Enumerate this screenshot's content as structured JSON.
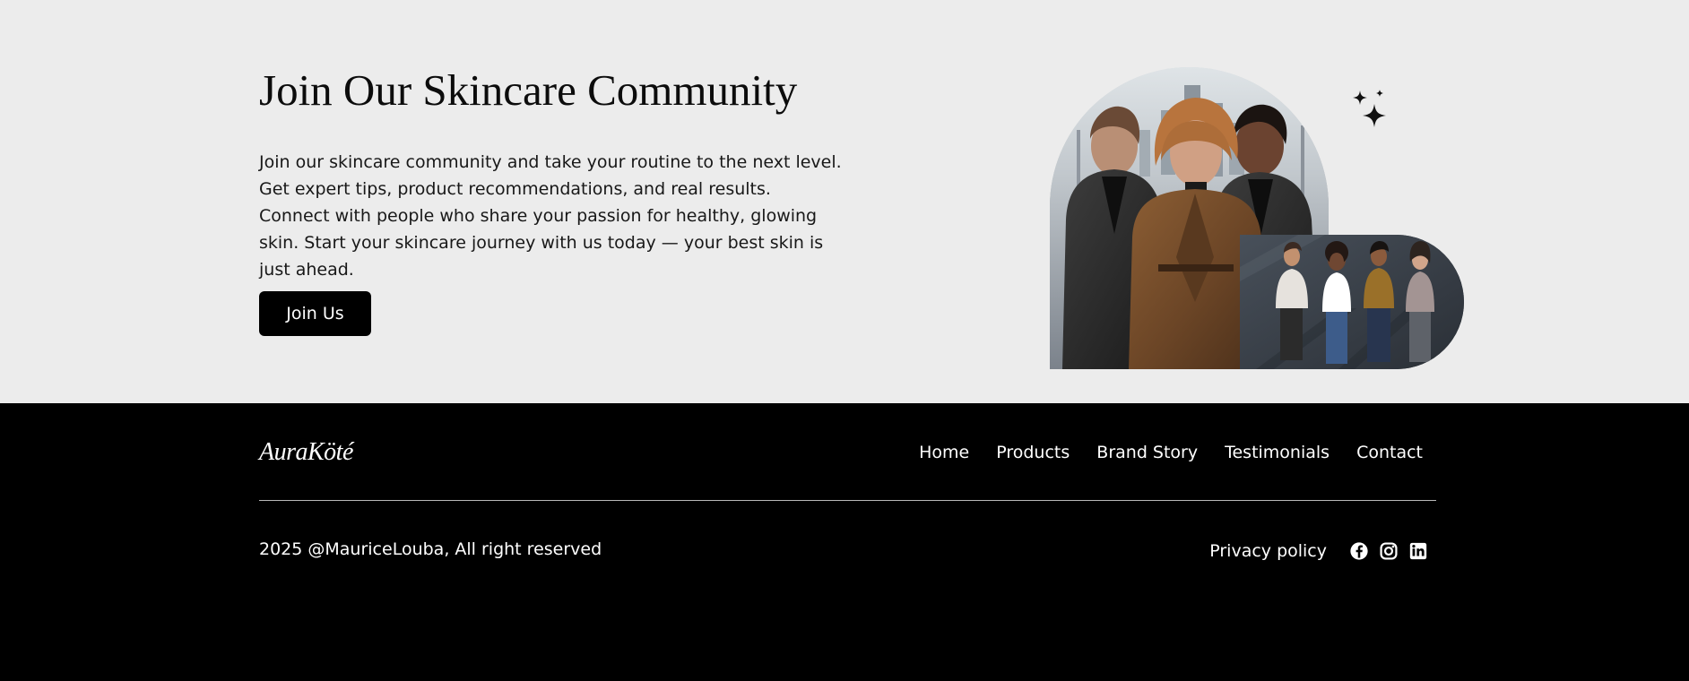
{
  "hero": {
    "title": "Join Our Skincare Community",
    "description": "Join our skincare community and take your routine to the next level. Get expert tips, product recommendations, and real results. Connect with people who share your passion for healthy, glowing skin. Start your skincare journey with us today — your best skin is just ahead.",
    "button_label": "Join Us",
    "images": {
      "primary": "community-portrait-photo",
      "secondary": "community-group-photo"
    },
    "decoration_icon": "sparkle-icon"
  },
  "footer": {
    "logo": "AuraKöté",
    "nav": [
      "Home",
      "Products",
      "Brand Story",
      "Testimonials",
      "Contact"
    ],
    "copyright": "2025 @MauriceLouba, All right reserved",
    "privacy_label": "Privacy policy",
    "social_icons": [
      "facebook-icon",
      "instagram-icon",
      "linkedin-icon"
    ]
  },
  "colors": {
    "hero_background": "#ececec",
    "footer_background": "#000000",
    "button_background": "#000000",
    "text_primary": "#111111",
    "text_inverse": "#ffffff",
    "divider": "#b8b8b8"
  }
}
